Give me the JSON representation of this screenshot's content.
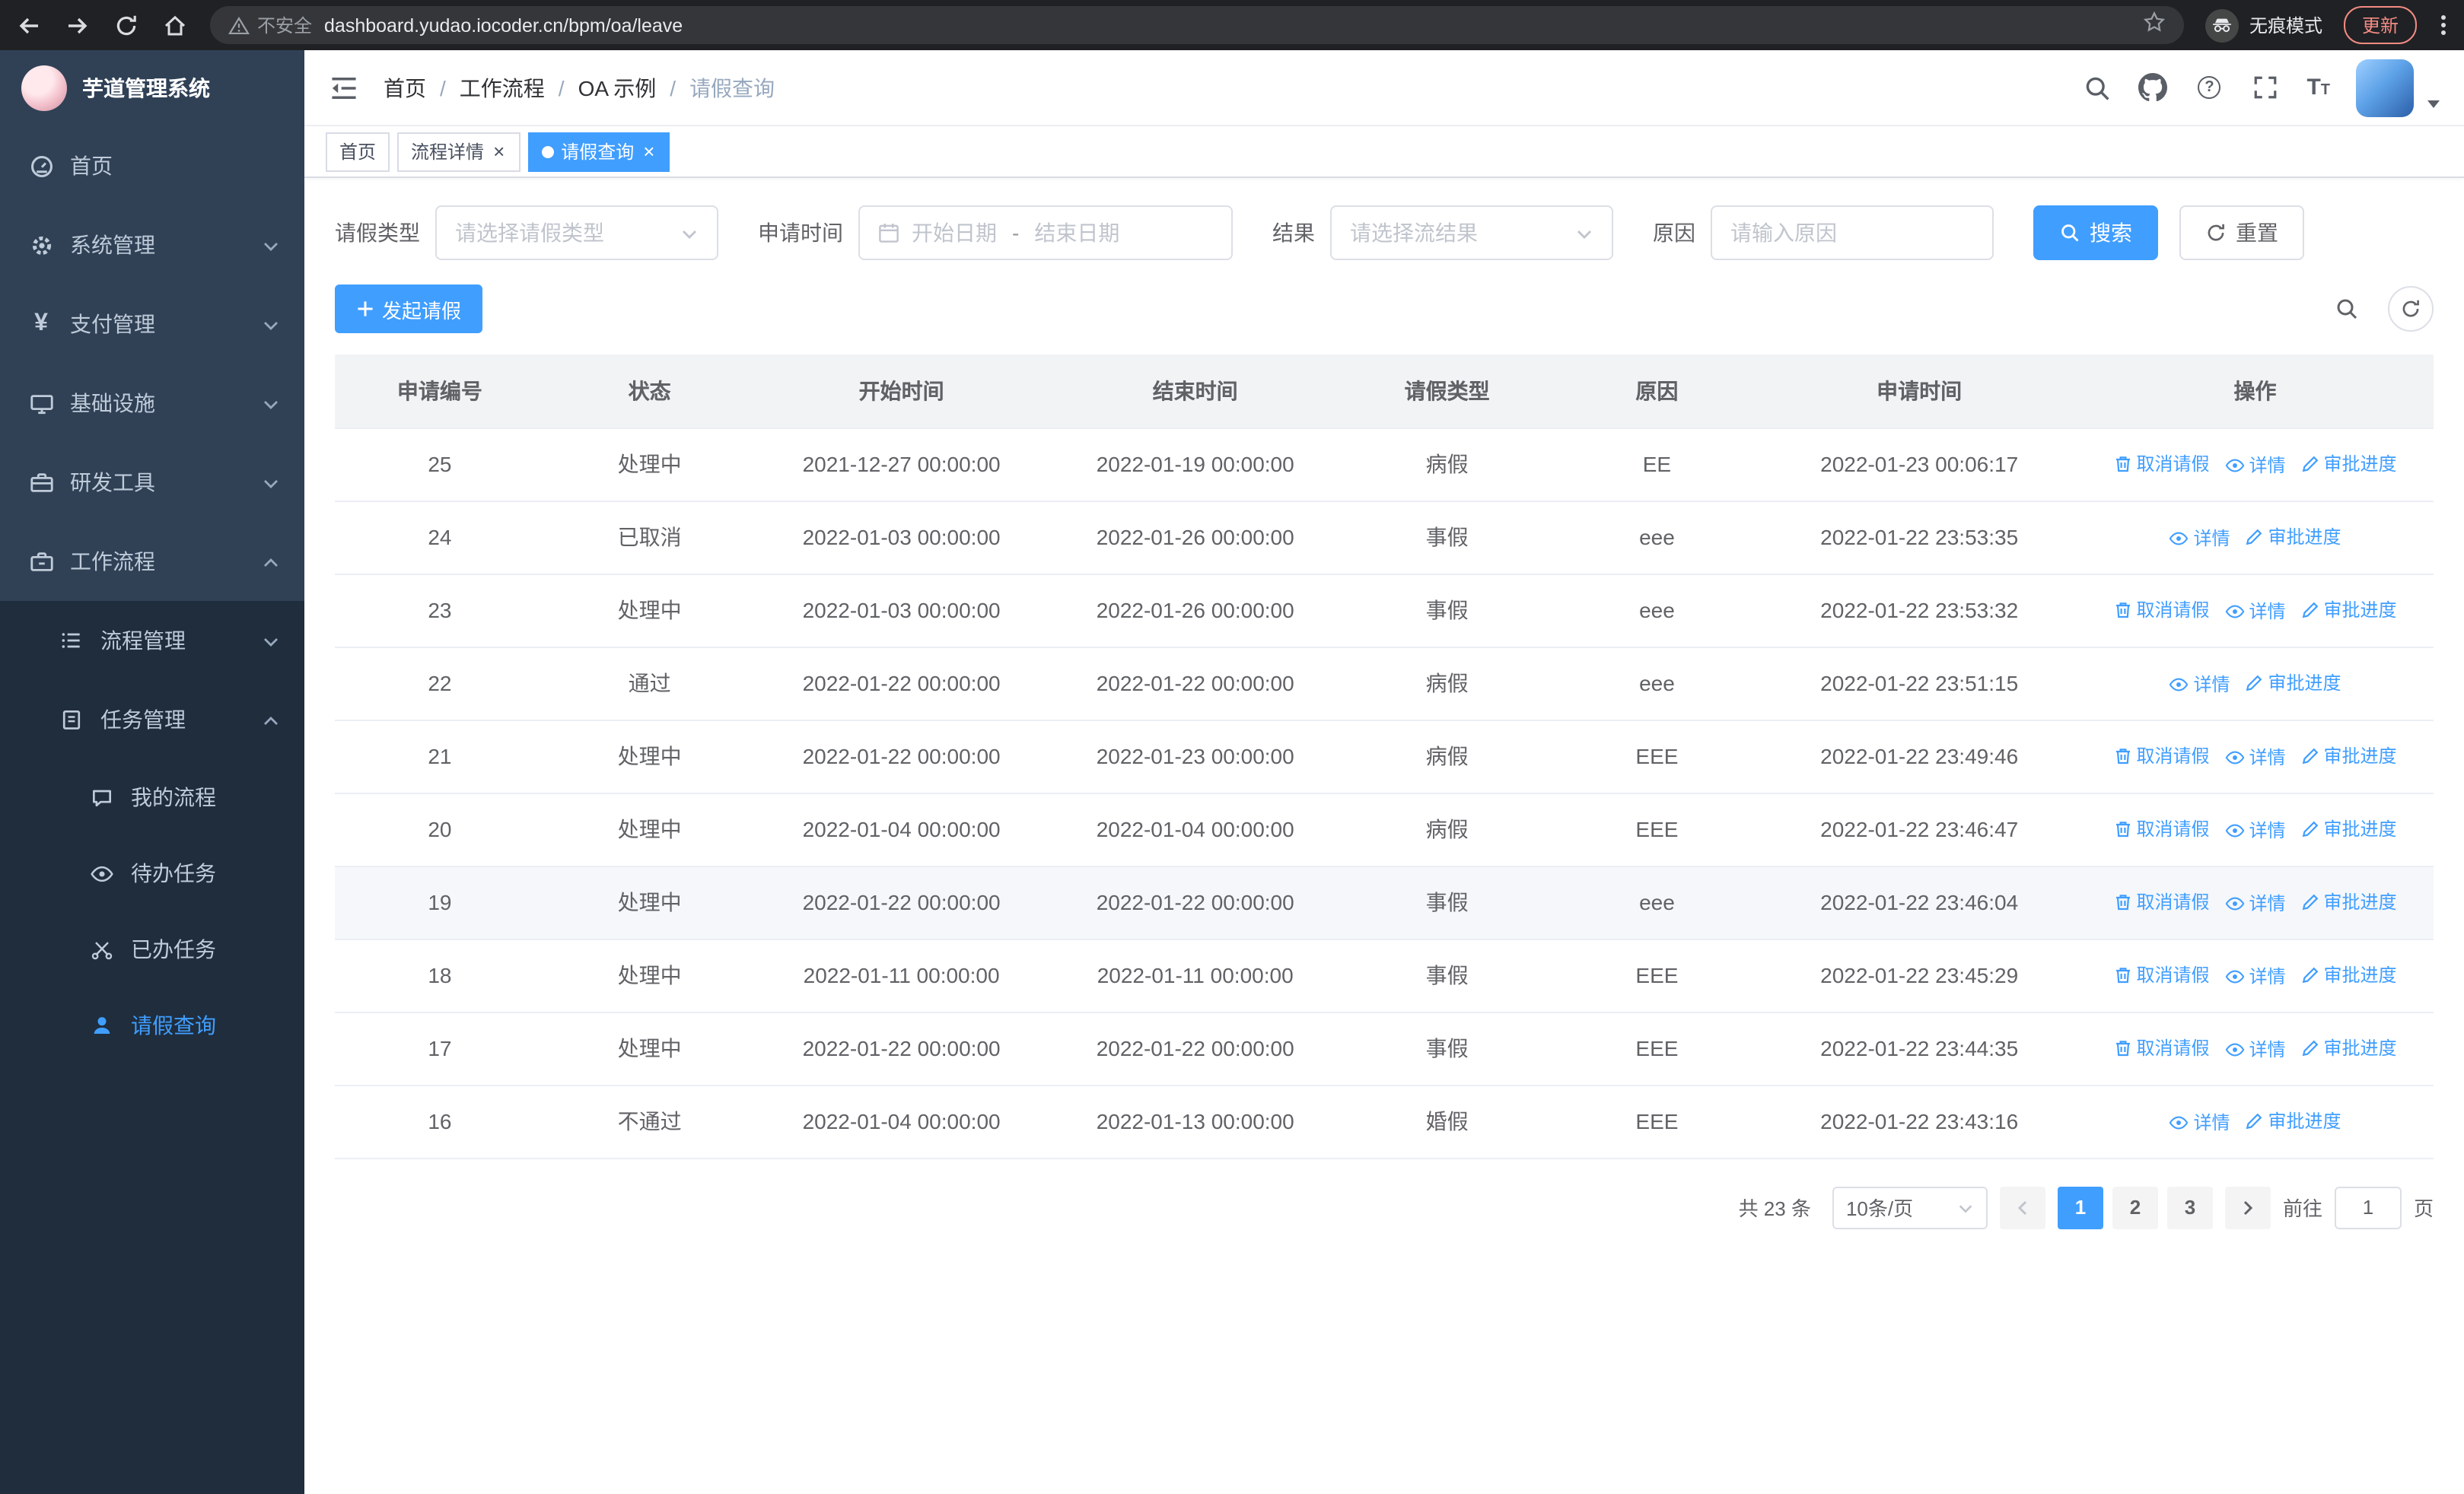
{
  "browser": {
    "security_label": "不安全",
    "url": "dashboard.yudao.iocoder.cn/bpm/oa/leave",
    "incognito_label": "无痕模式",
    "update_label": "更新"
  },
  "sidebar": {
    "title": "芋道管理系统",
    "items": [
      {
        "label": "首页"
      },
      {
        "label": "系统管理"
      },
      {
        "label": "支付管理"
      },
      {
        "label": "基础设施"
      },
      {
        "label": "研发工具"
      },
      {
        "label": "工作流程"
      }
    ],
    "submenu": {
      "process_mgmt": "流程管理",
      "task_mgmt": "任务管理",
      "children": [
        {
          "label": "我的流程"
        },
        {
          "label": "待办任务"
        },
        {
          "label": "已办任务"
        },
        {
          "label": "请假查询"
        }
      ]
    }
  },
  "breadcrumb": {
    "items": [
      "首页",
      "工作流程",
      "OA 示例",
      "请假查询"
    ],
    "separator": "/"
  },
  "tabs": [
    {
      "label": "首页"
    },
    {
      "label": "流程详情"
    },
    {
      "label": "请假查询"
    }
  ],
  "filters": {
    "type_label": "请假类型",
    "type_placeholder": "请选择请假类型",
    "time_label": "申请时间",
    "start_placeholder": "开始日期",
    "range_separator": "-",
    "end_placeholder": "结束日期",
    "result_label": "结果",
    "result_placeholder": "请选择流结果",
    "reason_label": "原因",
    "reason_placeholder": "请输入原因",
    "search_label": "搜索",
    "reset_label": "重置"
  },
  "toolbar": {
    "create_label": "发起请假"
  },
  "table": {
    "headers": [
      "申请编号",
      "状态",
      "开始时间",
      "结束时间",
      "请假类型",
      "原因",
      "申请时间",
      "操作"
    ],
    "action_labels": {
      "cancel": "取消请假",
      "detail": "详情",
      "progress": "审批进度"
    },
    "rows": [
      {
        "id": "25",
        "status": "处理中",
        "start": "2021-12-27 00:00:00",
        "end": "2022-01-19 00:00:00",
        "type": "病假",
        "reason": "EE",
        "applied": "2022-01-23 00:06:17",
        "actions": [
          "cancel",
          "detail",
          "progress"
        ]
      },
      {
        "id": "24",
        "status": "已取消",
        "start": "2022-01-03 00:00:00",
        "end": "2022-01-26 00:00:00",
        "type": "事假",
        "reason": "eee",
        "applied": "2022-01-22 23:53:35",
        "actions": [
          "detail",
          "progress"
        ]
      },
      {
        "id": "23",
        "status": "处理中",
        "start": "2022-01-03 00:00:00",
        "end": "2022-01-26 00:00:00",
        "type": "事假",
        "reason": "eee",
        "applied": "2022-01-22 23:53:32",
        "actions": [
          "cancel",
          "detail",
          "progress"
        ]
      },
      {
        "id": "22",
        "status": "通过",
        "start": "2022-01-22 00:00:00",
        "end": "2022-01-22 00:00:00",
        "type": "病假",
        "reason": "eee",
        "applied": "2022-01-22 23:51:15",
        "actions": [
          "detail",
          "progress"
        ]
      },
      {
        "id": "21",
        "status": "处理中",
        "start": "2022-01-22 00:00:00",
        "end": "2022-01-23 00:00:00",
        "type": "病假",
        "reason": "EEE",
        "applied": "2022-01-22 23:49:46",
        "actions": [
          "cancel",
          "detail",
          "progress"
        ]
      },
      {
        "id": "20",
        "status": "处理中",
        "start": "2022-01-04 00:00:00",
        "end": "2022-01-04 00:00:00",
        "type": "病假",
        "reason": "EEE",
        "applied": "2022-01-22 23:46:47",
        "actions": [
          "cancel",
          "detail",
          "progress"
        ]
      },
      {
        "id": "19",
        "status": "处理中",
        "start": "2022-01-22 00:00:00",
        "end": "2022-01-22 00:00:00",
        "type": "事假",
        "reason": "eee",
        "applied": "2022-01-22 23:46:04",
        "actions": [
          "cancel",
          "detail",
          "progress"
        ],
        "highlight": true
      },
      {
        "id": "18",
        "status": "处理中",
        "start": "2022-01-11 00:00:00",
        "end": "2022-01-11 00:00:00",
        "type": "事假",
        "reason": "EEE",
        "applied": "2022-01-22 23:45:29",
        "actions": [
          "cancel",
          "detail",
          "progress"
        ]
      },
      {
        "id": "17",
        "status": "处理中",
        "start": "2022-01-22 00:00:00",
        "end": "2022-01-22 00:00:00",
        "type": "事假",
        "reason": "EEE",
        "applied": "2022-01-22 23:44:35",
        "actions": [
          "cancel",
          "detail",
          "progress"
        ]
      },
      {
        "id": "16",
        "status": "不通过",
        "start": "2022-01-04 00:00:00",
        "end": "2022-01-13 00:00:00",
        "type": "婚假",
        "reason": "EEE",
        "applied": "2022-01-22 23:43:16",
        "actions": [
          "detail",
          "progress"
        ]
      }
    ]
  },
  "pagination": {
    "total_label": "共 23 条",
    "page_size_label": "10条/页",
    "pages": [
      "1",
      "2",
      "3"
    ],
    "current": "1",
    "goto_label": "前往",
    "goto_value": "1",
    "page_unit": "页"
  },
  "colors": {
    "primary": "#409EFF",
    "sidebar_bg": "#1f2d3d",
    "sidebar_item_bg": "#304156"
  }
}
